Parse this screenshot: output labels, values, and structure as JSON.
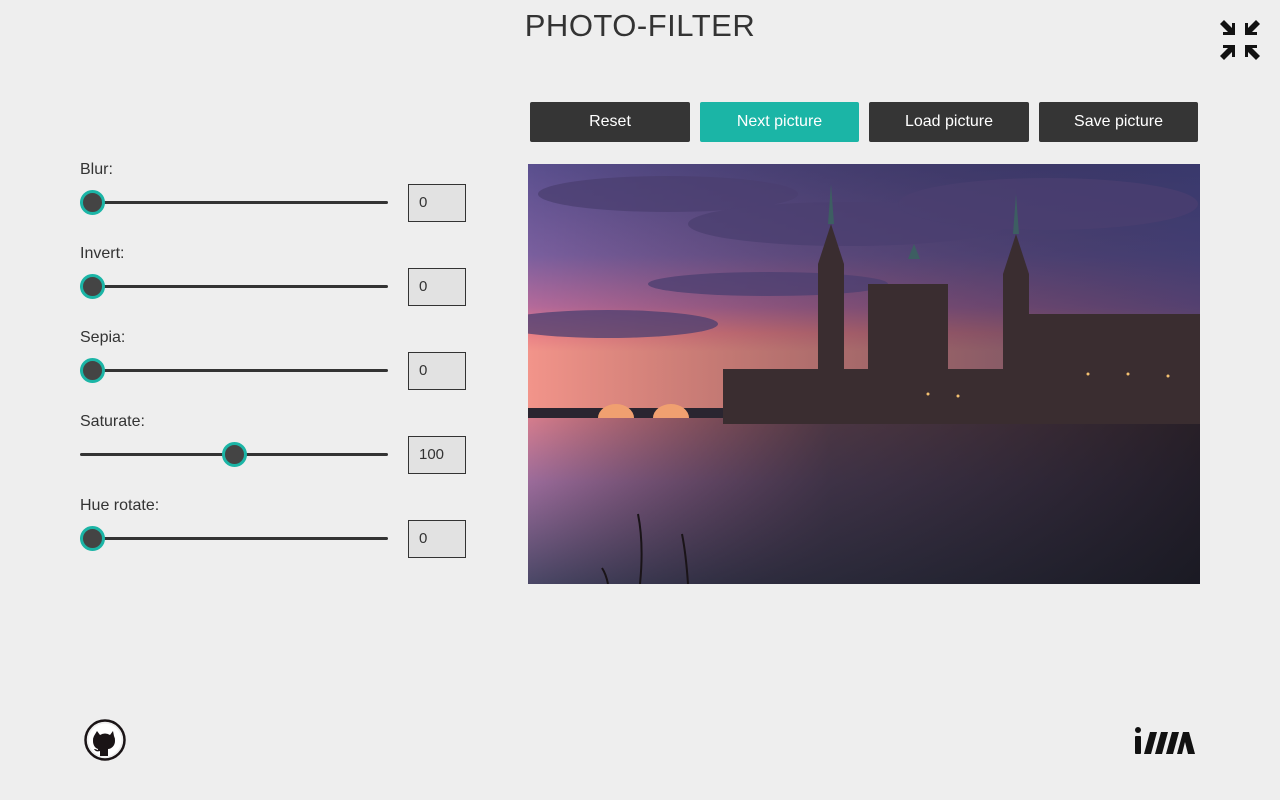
{
  "app": {
    "title": "PHOTO-FILTER"
  },
  "icons": {
    "fullscreen": "fullscreen-exit-icon",
    "github": "github-icon",
    "school_logo": "rs-logo-icon"
  },
  "colors": {
    "accent": "#1bb5a6",
    "button": "#353535",
    "background": "#eeeeee"
  },
  "filters": [
    {
      "label": "Blur:",
      "value": "0",
      "fraction": 0.0
    },
    {
      "label": "Invert:",
      "value": "0",
      "fraction": 0.0
    },
    {
      "label": "Sepia:",
      "value": "0",
      "fraction": 0.0
    },
    {
      "label": "Saturate:",
      "value": "100",
      "fraction": 0.5
    },
    {
      "label": "Hue rotate:",
      "value": "0",
      "fraction": 0.0
    }
  ],
  "buttons": {
    "reset": "Reset",
    "next": "Next picture",
    "load": "Load picture",
    "save": "Save picture"
  }
}
